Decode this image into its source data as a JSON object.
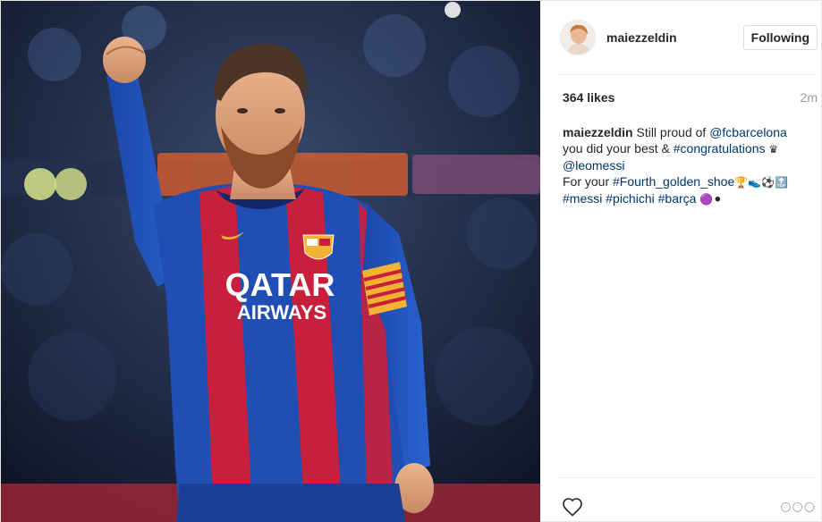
{
  "header": {
    "username": "maiezzeldin",
    "follow_label": "Following"
  },
  "post": {
    "likes": "364 likes",
    "time": "2m",
    "photo_text": {
      "sponsor_line1": "QATAR",
      "sponsor_line2": "AIRWAYS"
    },
    "caption": {
      "user": "maiezzeldin",
      "p1": "Still proud of ",
      "mention1": "@fcbarcelona",
      "p2": "you did your best & ",
      "tag1": "#congratulations",
      "emoji1": "♛",
      "mention2": "@leomessi",
      "p3": "For your ",
      "tag2": "#Fourth_golden_shoe",
      "emoji2": "🏆👟⚽🔝",
      "tag3": "#messi",
      "tag4": "#pichichi",
      "tag5": "#barça",
      "emoji3": "🟣⚫"
    }
  },
  "icons": {
    "like": "heart-icon",
    "more": "more-icon",
    "more_glyph": "○○○"
  },
  "colors": {
    "link": "#003569",
    "muted": "#999999",
    "text": "#262626",
    "jersey_blue": "#1f4fb5",
    "jersey_red": "#c81f3c"
  }
}
